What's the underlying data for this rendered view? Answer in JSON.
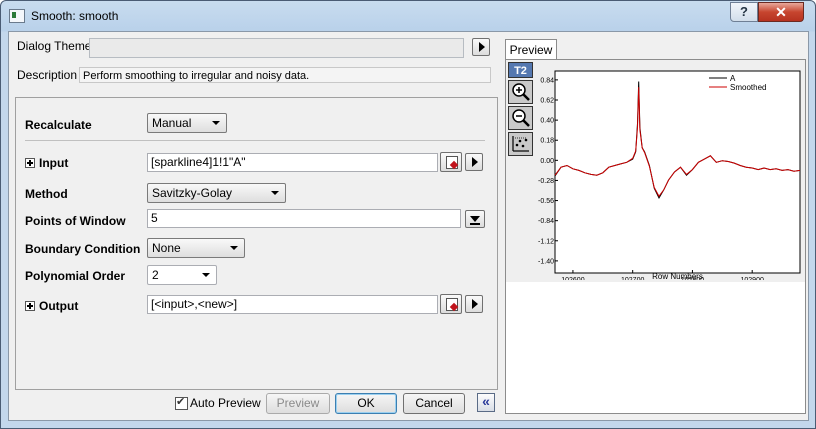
{
  "window": {
    "title": "Smooth: smooth",
    "help_label": "?",
    "close_label": "✕"
  },
  "theme": {
    "label": "Dialog Theme",
    "value": ""
  },
  "description": {
    "label": "Description",
    "text": "Perform smoothing to irregular and noisy data."
  },
  "fields": {
    "recalculate": {
      "label": "Recalculate",
      "value": "Manual"
    },
    "input": {
      "label": "Input",
      "value": "[sparkline4]1!1\"A\""
    },
    "method": {
      "label": "Method",
      "value": "Savitzky-Golay"
    },
    "points": {
      "label": "Points of Window",
      "value": "5"
    },
    "boundary": {
      "label": "Boundary Condition",
      "value": "None"
    },
    "polyorder": {
      "label": "Polynomial Order",
      "value": "2"
    },
    "output": {
      "label": "Output",
      "value": "[<input>,<new>]"
    }
  },
  "buttons": {
    "auto_preview_label": "Auto Preview",
    "auto_preview_checked": true,
    "preview": "Preview",
    "ok": "OK",
    "cancel": "Cancel",
    "collapse": "«"
  },
  "preview": {
    "tab_label": "Preview",
    "toolbar": {
      "t2": "T2",
      "icons": [
        "zoom-in-icon",
        "zoom-out-icon",
        "data-reader-icon"
      ]
    }
  },
  "chart_data": {
    "type": "line",
    "xlabel": "Row Numbers",
    "ylabel": "A",
    "xlim": [
      102570,
      102980
    ],
    "ylim": [
      -1.55,
      0.95
    ],
    "xticks": [
      102600,
      102700,
      102800,
      102900
    ],
    "yticks": [
      0.84,
      0.62,
      0.4,
      0.18,
      -0.04,
      -0.26,
      -0.48,
      -0.7,
      -0.92,
      -1.14,
      -1.4
    ],
    "ytick_labels": [
      "0.84",
      "0.62",
      "0.40",
      "0.18",
      "0.00",
      "-0.28",
      "-0.56",
      "-0.84",
      "-1.12",
      "-1.40"
    ],
    "legend_position": "top-right",
    "series": [
      {
        "name": "A",
        "color": "#000000",
        "x": [
          102570,
          102580,
          102590,
          102600,
          102610,
          102620,
          102630,
          102640,
          102650,
          102660,
          102670,
          102680,
          102690,
          102700,
          102705,
          102708,
          102710,
          102712,
          102716,
          102720,
          102728,
          102736,
          102744,
          102752,
          102760,
          102770,
          102780,
          102790,
          102800,
          102810,
          102820,
          102830,
          102840,
          102850,
          102860,
          102870,
          102880,
          102890,
          102900,
          102910,
          102920,
          102930,
          102940,
          102950,
          102960,
          102970,
          102980
        ],
        "y": [
          -0.35,
          -0.24,
          -0.22,
          -0.26,
          -0.28,
          -0.31,
          -0.33,
          -0.34,
          -0.31,
          -0.24,
          -0.22,
          -0.2,
          -0.18,
          -0.14,
          -0.05,
          0.3,
          0.82,
          0.25,
          0.0,
          -0.05,
          -0.22,
          -0.5,
          -0.62,
          -0.52,
          -0.4,
          -0.3,
          -0.24,
          -0.34,
          -0.27,
          -0.18,
          -0.14,
          -0.1,
          -0.18,
          -0.16,
          -0.17,
          -0.19,
          -0.22,
          -0.24,
          -0.25,
          -0.27,
          -0.25,
          -0.27,
          -0.26,
          -0.28,
          -0.27,
          -0.29,
          -0.28
        ]
      },
      {
        "name": "Smoothed",
        "color": "#cc0000",
        "x": [
          102570,
          102580,
          102590,
          102600,
          102610,
          102620,
          102630,
          102640,
          102650,
          102660,
          102670,
          102680,
          102690,
          102700,
          102705,
          102708,
          102710,
          102712,
          102716,
          102720,
          102728,
          102736,
          102744,
          102752,
          102760,
          102770,
          102780,
          102790,
          102800,
          102810,
          102820,
          102830,
          102840,
          102850,
          102860,
          102870,
          102880,
          102890,
          102900,
          102910,
          102920,
          102930,
          102940,
          102950,
          102960,
          102970,
          102980
        ],
        "y": [
          -0.34,
          -0.24,
          -0.22,
          -0.26,
          -0.28,
          -0.31,
          -0.33,
          -0.34,
          -0.31,
          -0.24,
          -0.22,
          -0.2,
          -0.18,
          -0.13,
          -0.04,
          0.25,
          0.75,
          0.22,
          0.0,
          -0.06,
          -0.23,
          -0.49,
          -0.6,
          -0.52,
          -0.4,
          -0.3,
          -0.24,
          -0.33,
          -0.27,
          -0.18,
          -0.14,
          -0.1,
          -0.18,
          -0.16,
          -0.17,
          -0.19,
          -0.22,
          -0.24,
          -0.25,
          -0.27,
          -0.25,
          -0.27,
          -0.26,
          -0.28,
          -0.27,
          -0.29,
          -0.28
        ]
      }
    ]
  }
}
